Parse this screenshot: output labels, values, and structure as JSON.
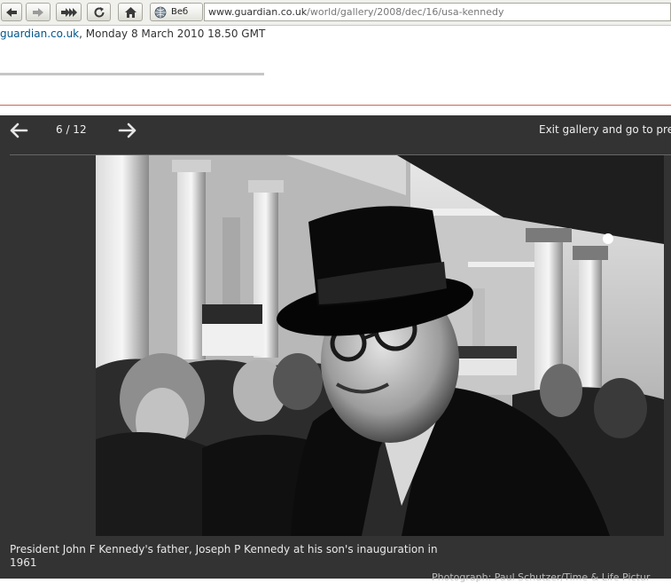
{
  "browser": {
    "back_icon": "back-arrow-icon",
    "forward_icon": "forward-arrow-icon",
    "reload_icon": "reload-icon",
    "home_icon": "home-icon",
    "search_engine_label": "Веб",
    "url_host": "www.guardian.co.uk",
    "url_path": "/world/gallery/2008/dec/16/usa-kennedy"
  },
  "page": {
    "site_link": "guardian.co.uk",
    "date_text": ", Monday 8 March 2010 18.50 GMT"
  },
  "gallery": {
    "counter": "6 / 12",
    "exit_label": "Exit gallery and go to pre",
    "caption": "President John F Kennedy's father, Joseph P Kennedy at his son's inauguration in 1961",
    "credit": "Photograph: Paul Schutzer/Time & Life Pictur"
  },
  "colors": {
    "link": "#005689",
    "gallery_bg": "#333333",
    "divider": "#c96a52"
  }
}
